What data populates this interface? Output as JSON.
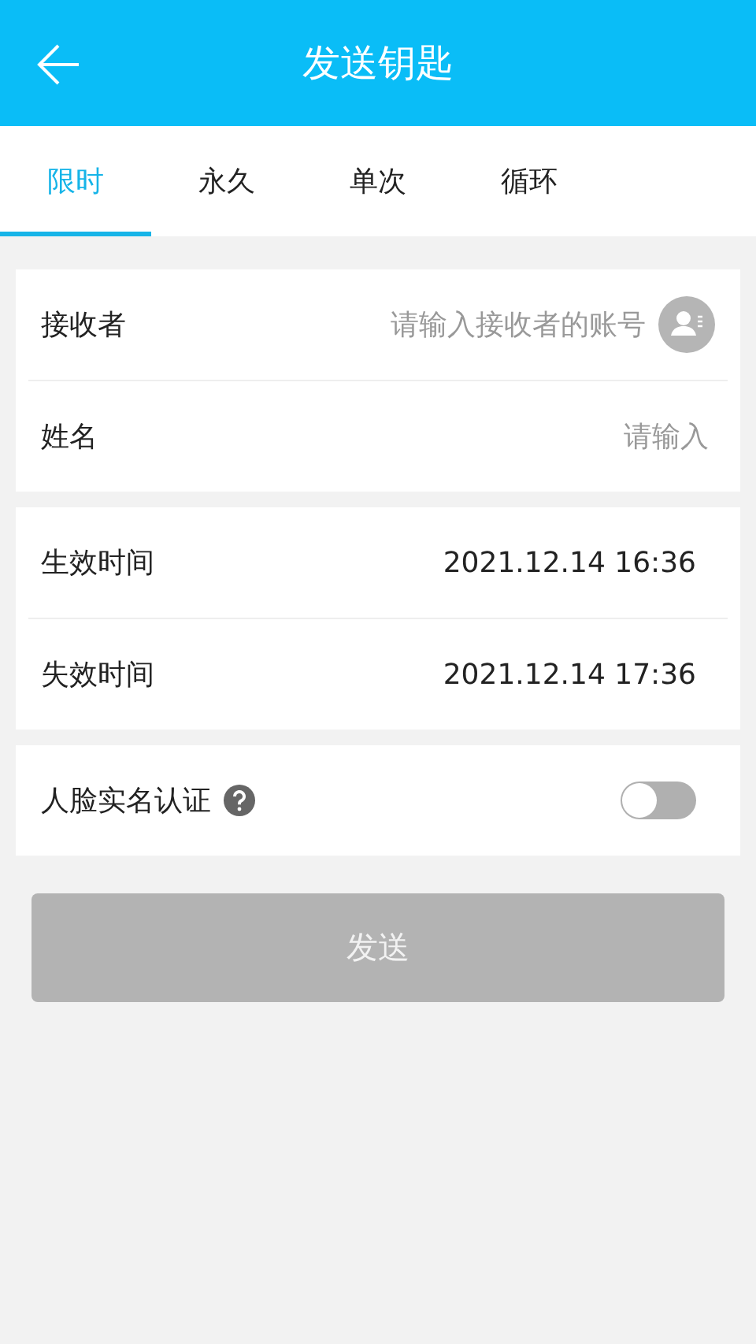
{
  "header": {
    "title": "发送钥匙"
  },
  "tabs": [
    {
      "label": "限时",
      "selected": true
    },
    {
      "label": "永久",
      "selected": false
    },
    {
      "label": "单次",
      "selected": false
    },
    {
      "label": "循环",
      "selected": false
    }
  ],
  "recipient": {
    "label": "接收者",
    "placeholder": "请输入接收者的账号"
  },
  "name": {
    "label": "姓名",
    "placeholder": "请输入"
  },
  "times": [
    {
      "label": "生效时间",
      "value": "2021.12.14 16:36"
    },
    {
      "label": "失效时间",
      "value": "2021.12.14 17:36"
    }
  ],
  "face_verification": {
    "label": "人脸实名认证",
    "on": false
  },
  "send_button": {
    "label": "发送",
    "disabled": true
  }
}
